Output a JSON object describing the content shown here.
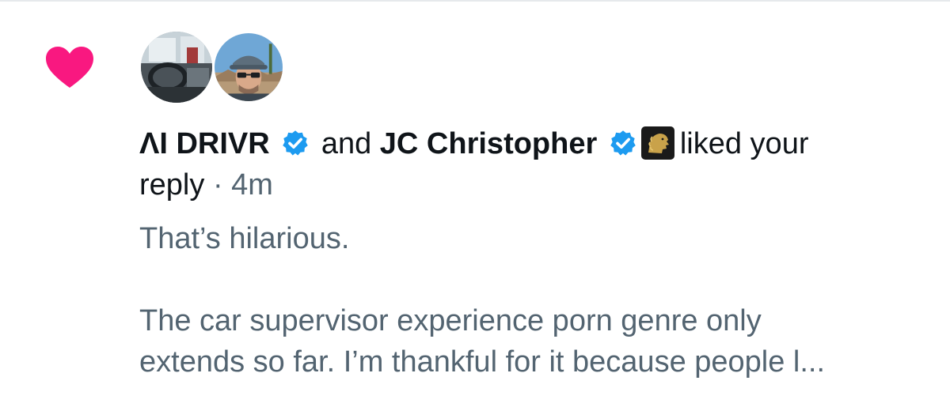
{
  "notification": {
    "icon": "heart-icon",
    "accent_color": "#f91880",
    "verified_color": "#1d9bf0",
    "users": [
      {
        "name": "ΛI DRIVR",
        "verified": true,
        "avatar": "steering-wheel-photo"
      },
      {
        "name": "JC Christopher",
        "verified": true,
        "avatar": "man-in-cap-photo",
        "affiliation_badge": "gold-lion-badge"
      }
    ],
    "connector": "and",
    "action": "liked your",
    "action_continued": "reply",
    "separator": "·",
    "time": "4m"
  },
  "reply": {
    "line1": "That’s hilarious.",
    "line2": "The car supervisor experience porn genre only",
    "line3": "extends so far. I’m thankful for it because people l..."
  }
}
